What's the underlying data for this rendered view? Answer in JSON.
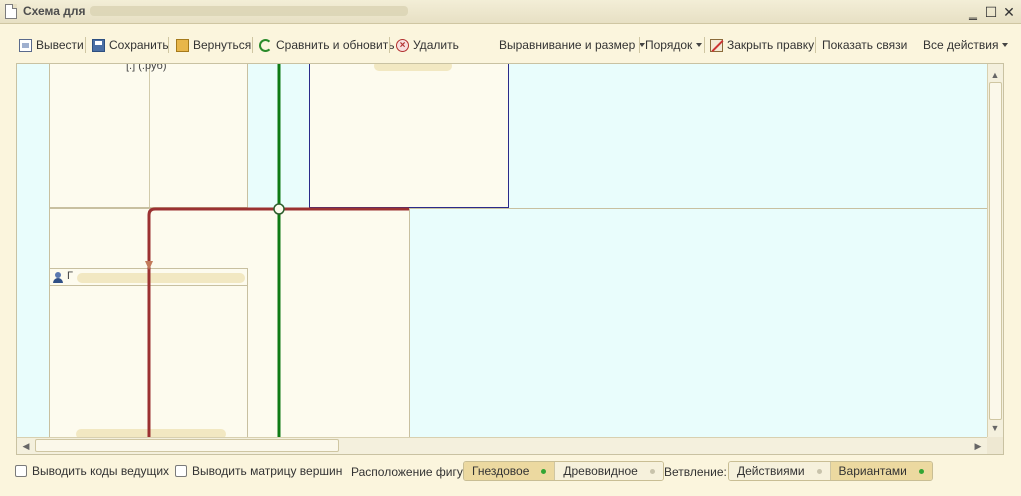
{
  "window": {
    "title": "Схема для",
    "minimize_symbol": "‗",
    "maximize_symbol": "☐",
    "close_symbol": "✕"
  },
  "toolbar": {
    "print_label": "Вывести",
    "save_label": "Сохранить",
    "back_label": "Вернуться",
    "compare_label": "Сравнить и обновить",
    "delete_label": "Удалить",
    "align_label": "Выравнивание и размер",
    "order_label": "Порядок",
    "close_edit_label": "Закрыть правку",
    "show_links_label": "Показать связи",
    "all_actions_label": "Все действия"
  },
  "canvas": {
    "node1_caption_fragment": "[.] (.руб)",
    "node3_caption_start": "Г"
  },
  "bottom": {
    "show_lead_codes_label": "Выводить коды ведущих",
    "show_vertex_matrix_label": "Выводить матрицу вершин",
    "layout_label": "Расположение фигур:",
    "layout_options": [
      "Гнездовое",
      "Древовидное"
    ],
    "layout_selected": "Гнездовое",
    "branching_label": "Ветвление:",
    "branching_options": [
      "Действиями",
      "Вариантами"
    ],
    "branching_selected": "Вариантами"
  },
  "colors": {
    "canvas_background": "#e9fdfc",
    "shape_fill": "#fdfbee",
    "green_line": "#0e7a14",
    "red_line": "#9b3131",
    "toggle_active": "#ecd9a0",
    "indicator_green": "#33a533"
  },
  "icons": [
    "document-icon",
    "print-icon",
    "save-icon",
    "back-icon",
    "refresh-icon",
    "delete-icon",
    "edit-cross-icon",
    "user-icon"
  ]
}
